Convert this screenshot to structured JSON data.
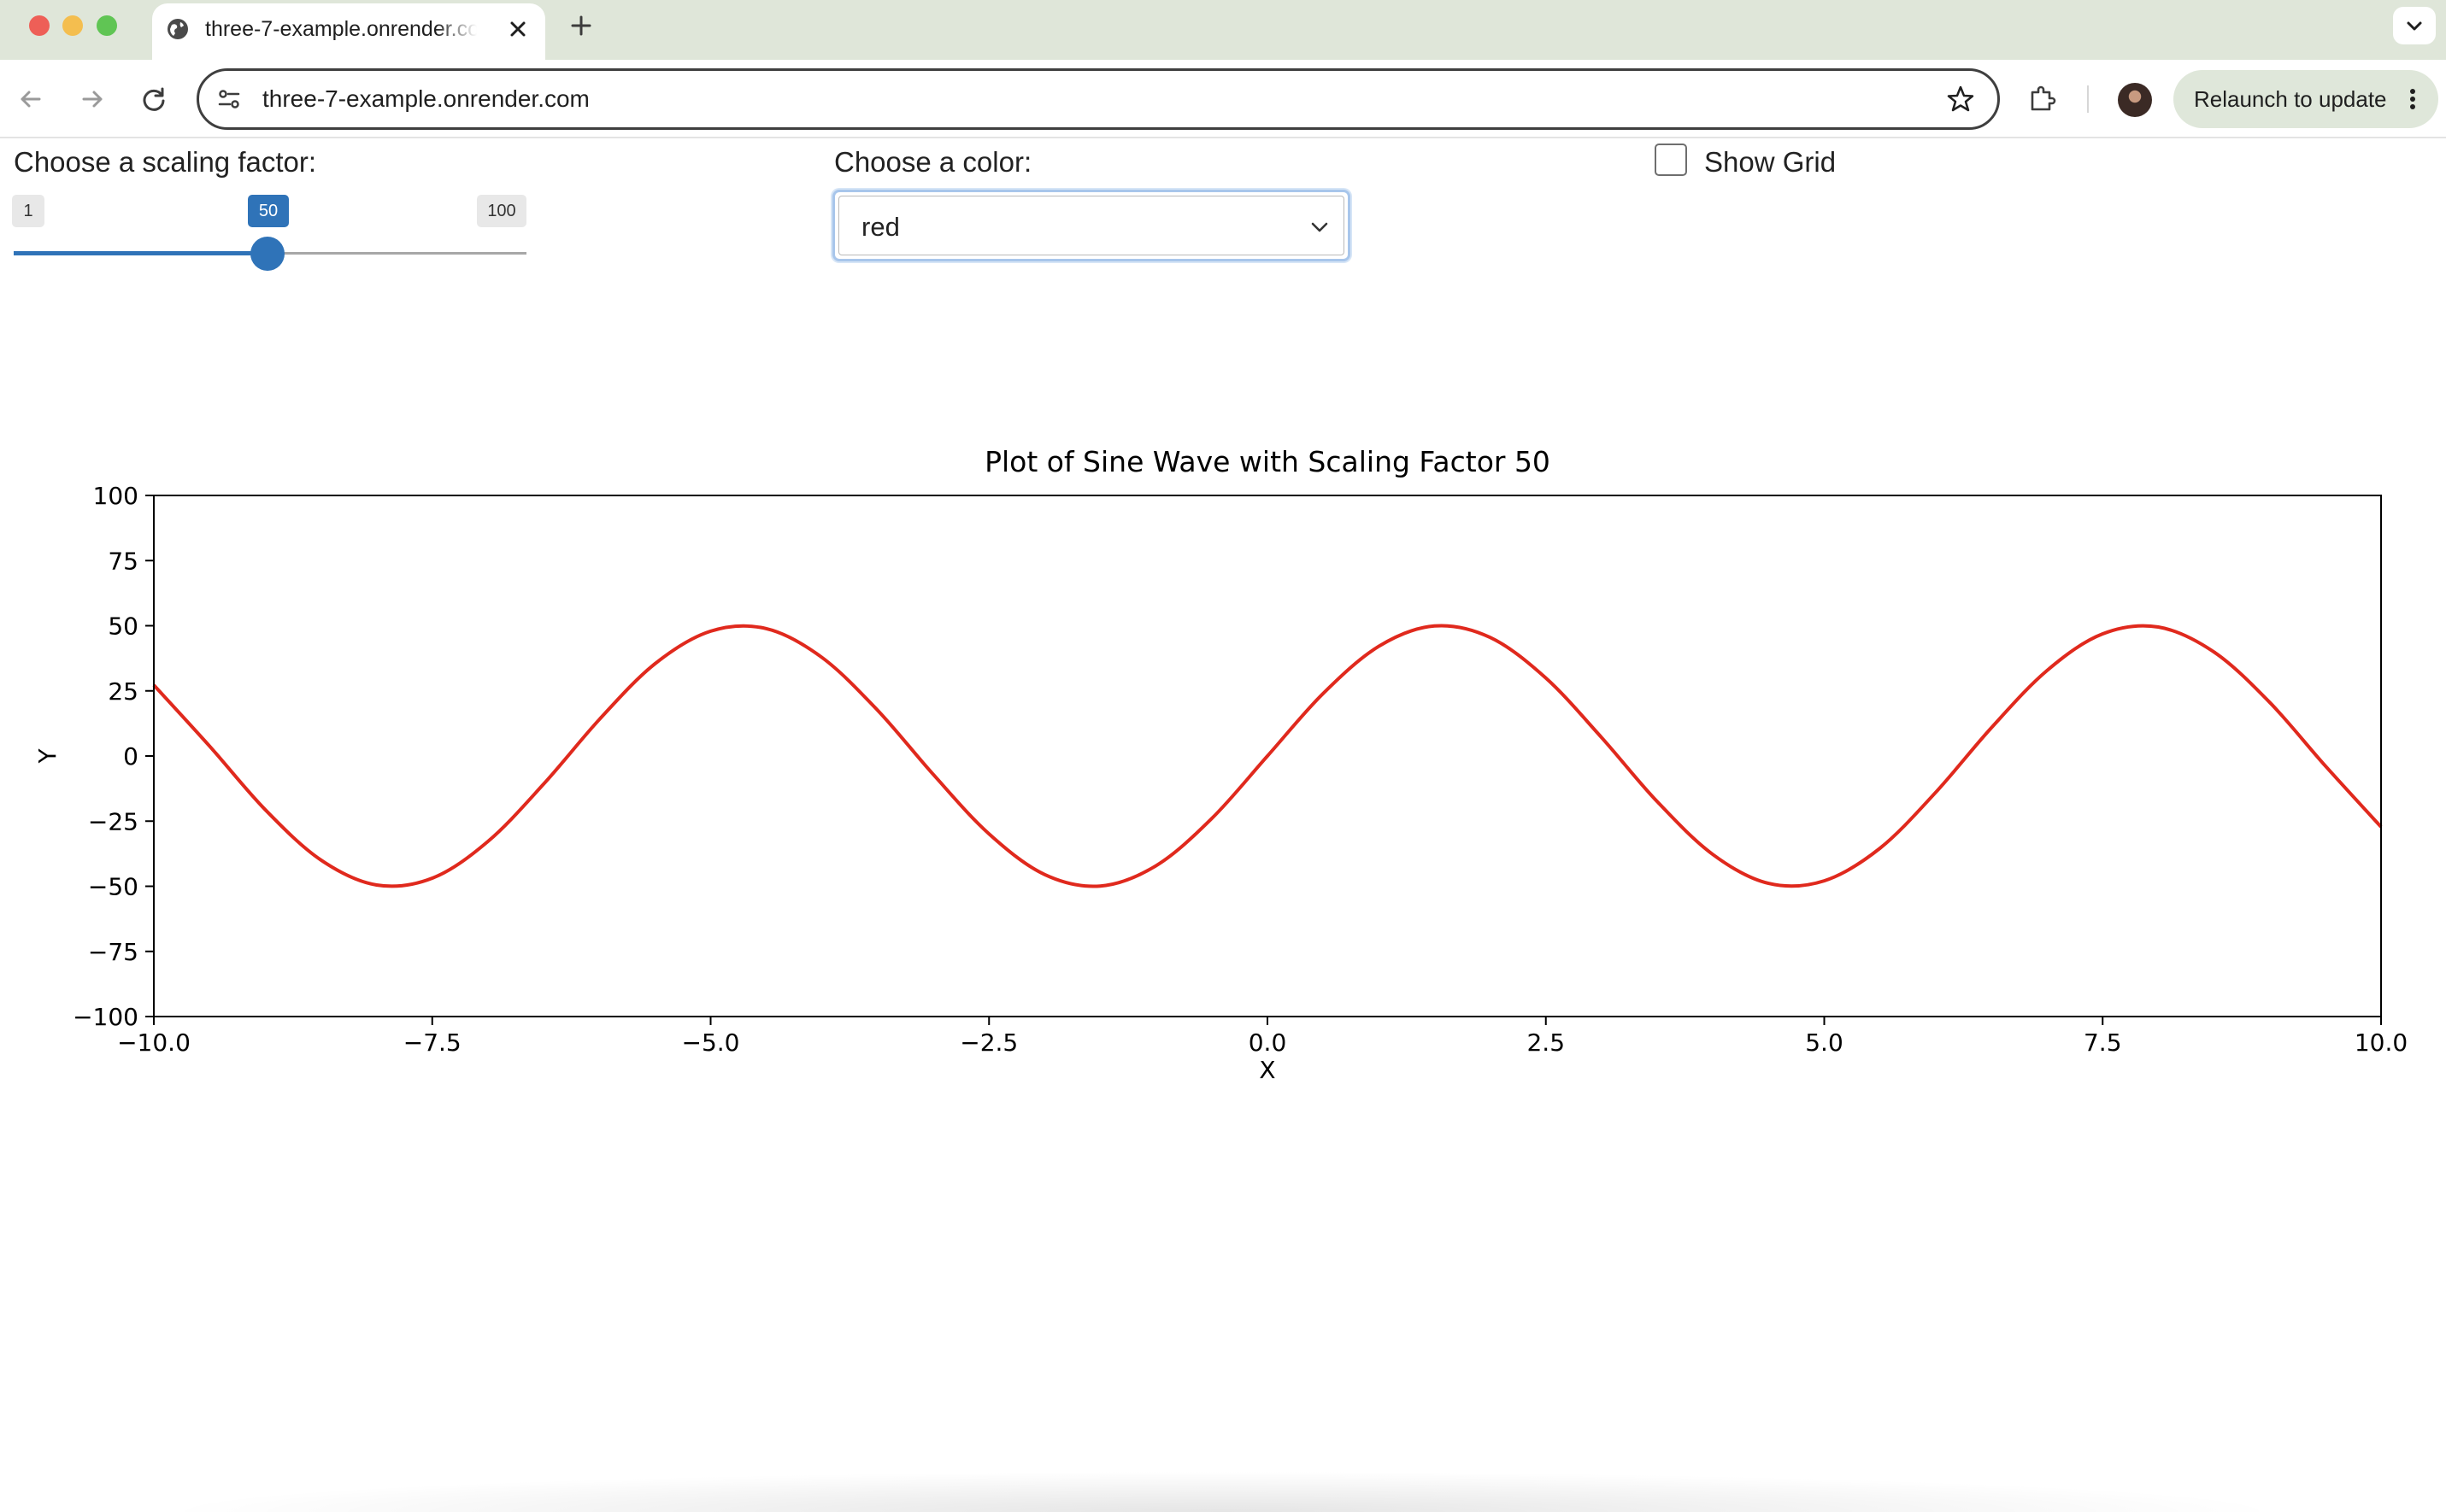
{
  "browser": {
    "tab_title": "three-7-example.onrender.com",
    "url": "three-7-example.onrender.com",
    "relaunch_label": "Relaunch to update"
  },
  "controls": {
    "scaling_label": "Choose a scaling factor:",
    "slider": {
      "min_label": "1",
      "max_label": "100",
      "value_label": "50",
      "min": 1,
      "max": 100,
      "value": 50
    },
    "color_label": "Choose a color:",
    "color_selected": "red",
    "grid_label": "Show Grid",
    "grid_checked": false
  },
  "colors": {
    "accent": "#2f73b8",
    "line": "#e0291d"
  },
  "chart_data": {
    "type": "line",
    "title": "Plot of Sine Wave with Scaling Factor 50",
    "xlabel": "X",
    "ylabel": "Y",
    "xlim": [
      -10.0,
      10.0
    ],
    "ylim": [
      -100,
      100
    ],
    "x_ticks": [
      "−10.0",
      "−7.5",
      "−5.0",
      "−2.5",
      "0.0",
      "2.5",
      "5.0",
      "7.5",
      "10.0"
    ],
    "y_ticks": [
      "100",
      "75",
      "50",
      "25",
      "0",
      "−25",
      "−50",
      "−75",
      "−100"
    ],
    "grid": false,
    "series": [
      {
        "color": "#e0291d",
        "x": [
          -10.0,
          -9.5,
          -9.0,
          -8.5,
          -8.0,
          -7.5,
          -7.0,
          -6.5,
          -6.0,
          -5.5,
          -5.0,
          -4.5,
          -4.0,
          -3.5,
          -3.0,
          -2.5,
          -2.0,
          -1.5,
          -1.0,
          -0.5,
          0.0,
          0.5,
          1.0,
          1.5,
          2.0,
          2.5,
          3.0,
          3.5,
          4.0,
          4.5,
          5.0,
          5.5,
          6.0,
          6.5,
          7.0,
          7.5,
          8.0,
          8.5,
          9.0,
          9.5,
          10.0
        ],
        "y": [
          27.2,
          3.8,
          -20.6,
          -39.9,
          -49.5,
          -46.9,
          -32.8,
          -10.8,
          14.0,
          35.4,
          47.9,
          48.9,
          37.8,
          17.5,
          -7.1,
          -29.9,
          -45.5,
          -49.9,
          -42.1,
          -24.0,
          0.0,
          24.0,
          42.1,
          49.9,
          45.5,
          29.9,
          7.1,
          -17.5,
          -37.8,
          -48.9,
          -47.9,
          -35.4,
          -14.0,
          10.8,
          32.8,
          46.9,
          49.5,
          39.9,
          20.6,
          -3.8,
          -27.2
        ]
      }
    ]
  }
}
